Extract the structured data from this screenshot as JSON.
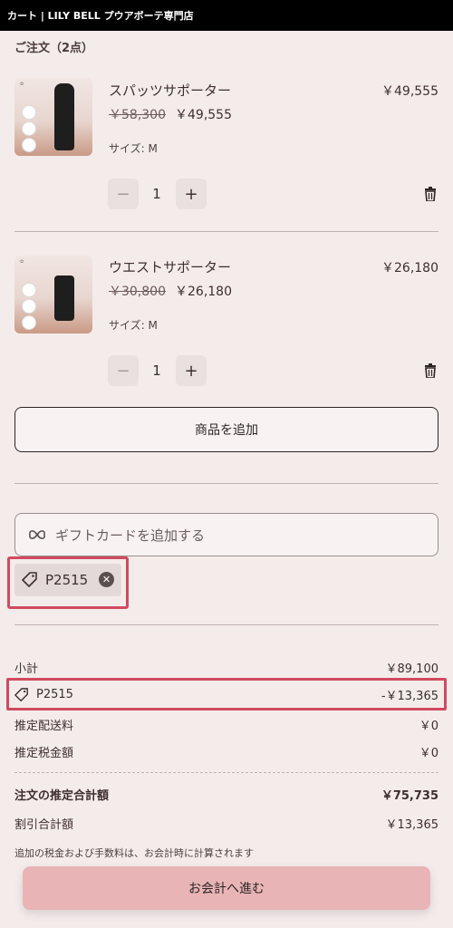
{
  "header": {
    "title": "カート | LILY BELL プウアボーテ専門店"
  },
  "order": {
    "title": "ご注文（2点）",
    "items": [
      {
        "name": "スパッツサポーター",
        "price": "￥49,555",
        "original_price": "￥58,300",
        "sale_price": "￥49,555",
        "size": "サイズ: M",
        "quantity": "1"
      },
      {
        "name": "ウエストサポーター",
        "price": "￥26,180",
        "original_price": "￥30,800",
        "sale_price": "￥26,180",
        "size": "サイズ: M",
        "quantity": "1"
      }
    ]
  },
  "controls": {
    "minus": "−",
    "plus": "+",
    "add_product": "商品を追加"
  },
  "gift": {
    "placeholder": "ギフトカードを追加する"
  },
  "coupon": {
    "code": "P2515",
    "remove": "✕"
  },
  "summary": {
    "subtotal_label": "小計",
    "subtotal_value": "￥89,100",
    "discount_code": "P2515",
    "discount_value": "-￥13,365",
    "shipping_label": "推定配送料",
    "shipping_value": "￥0",
    "tax_label": "推定税金額",
    "tax_value": "￥0",
    "total_label": "注文の推定合計額",
    "total_value": "￥75,735",
    "discount_total_label": "割引合計額",
    "discount_total_value": "￥13,365",
    "note": "追加の税金および手数料は、お会計時に計算されます"
  },
  "checkout": {
    "label": "お会計へ進む"
  },
  "colors": {
    "background": "#f4eceb",
    "accent": "#e8b4b6",
    "highlight": "#d04a5e"
  },
  "icons": {
    "trash": "trash-icon",
    "tag": "tag-icon",
    "gift": "bow-icon",
    "remove": "close-icon"
  }
}
